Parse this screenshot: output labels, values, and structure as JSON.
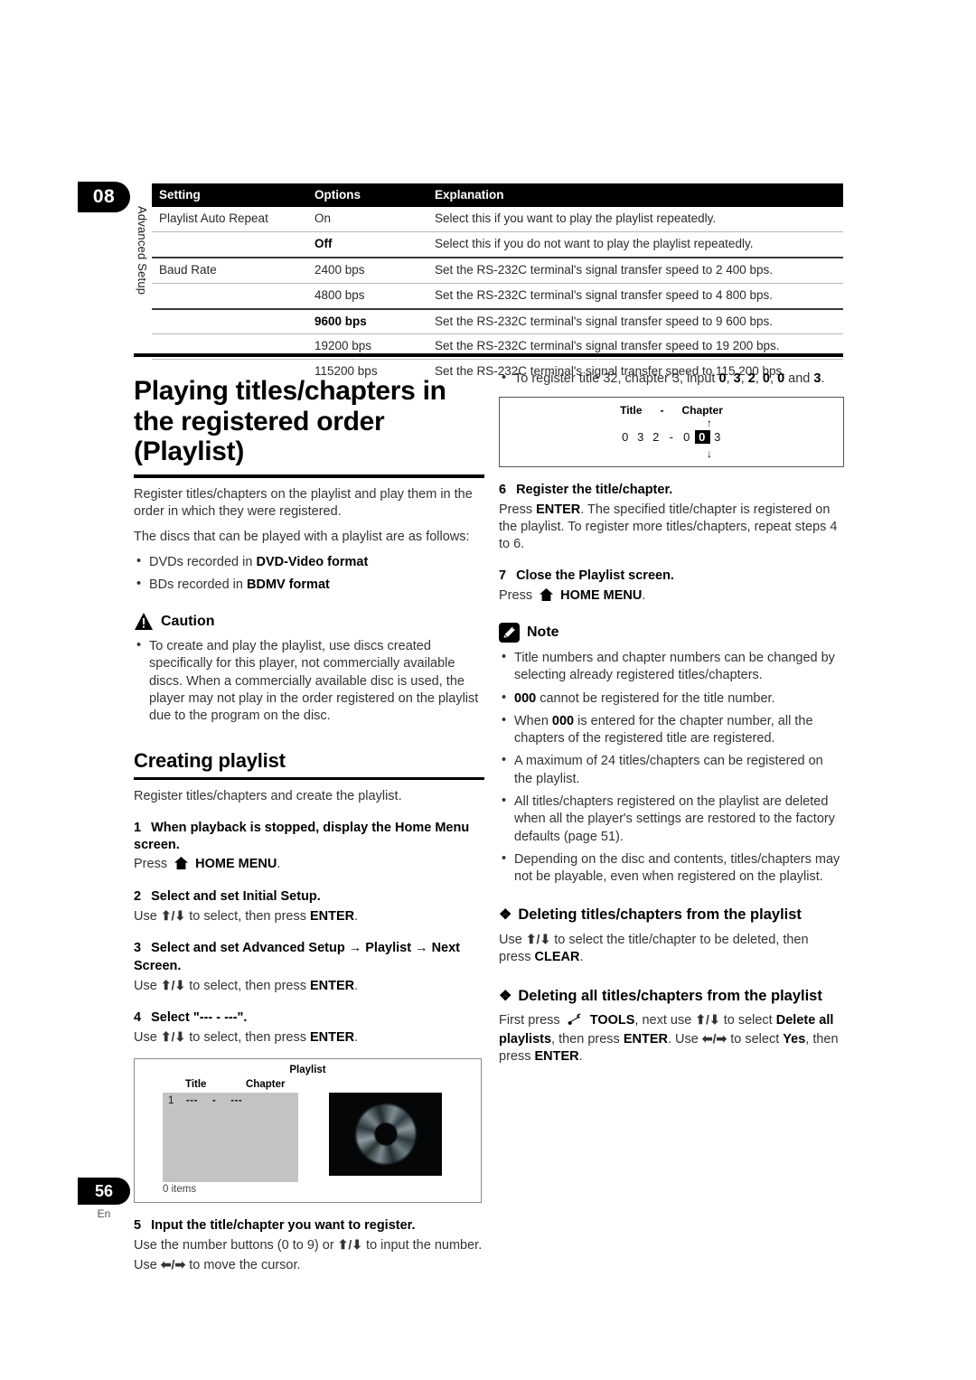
{
  "chapter": {
    "number": "08",
    "vertical_label": "Advanced Setup"
  },
  "settings_table": {
    "headers": [
      "Setting",
      "Options",
      "Explanation"
    ],
    "rows": [
      {
        "setting": "Playlist Auto Repeat",
        "option": "On",
        "option_bold": false,
        "explanation": "Select this if you want to play the playlist repeatedly.",
        "rule": "none"
      },
      {
        "setting": "",
        "option": "Off",
        "option_bold": true,
        "explanation": "Select this if you do not want to play the playlist repeatedly.",
        "rule": "thin"
      },
      {
        "setting": "Baud Rate",
        "option": "2400 bps",
        "option_bold": false,
        "explanation": "Set the RS-232C terminal's signal transfer speed to 2 400 bps.",
        "rule": "thick"
      },
      {
        "setting": "",
        "option": "4800 bps",
        "option_bold": false,
        "explanation": "Set the RS-232C terminal's signal transfer speed to 4 800 bps.",
        "rule": "thin"
      },
      {
        "setting": "",
        "option": "9600 bps",
        "option_bold": true,
        "explanation": "Set the RS-232C terminal's signal transfer speed to 9 600 bps.",
        "rule": "thick"
      },
      {
        "setting": "",
        "option": "19200 bps",
        "option_bold": false,
        "explanation": "Set the RS-232C terminal's signal transfer speed to 19 200 bps.",
        "rule": "thin"
      },
      {
        "setting": "",
        "option": "115200 bps",
        "option_bold": false,
        "explanation": "Set the RS-232C terminal's signal transfer speed to 115 200 bps.",
        "rule": "thin"
      }
    ]
  },
  "main": {
    "title": "Playing titles/chapters in the registered order (Playlist)",
    "intro1": "Register titles/chapters on the playlist and play them in the order in which they were registered.",
    "intro2": "The discs that can be played with a playlist are as follows:",
    "disc_bullets": [
      {
        "prefix": "DVDs recorded in ",
        "bold": "DVD-Video format"
      },
      {
        "prefix": "BDs recorded in ",
        "bold": "BDMV format"
      }
    ]
  },
  "caution": {
    "label": "Caution",
    "icon": "warning-triangle-icon",
    "bullets": [
      "To create and play the playlist, use discs created specifically for this player, not commercially available discs. When a commercially available disc is used, the player may not play in the order registered on the playlist due to the program on the disc."
    ]
  },
  "creating": {
    "heading": "Creating playlist",
    "intro": "Register titles/chapters and create the playlist.",
    "steps": [
      {
        "num": "1",
        "head": "When playback is stopped, display the Home Menu screen.",
        "body_pre": "Press",
        "body_icon": "home-icon",
        "body_bold": "HOME MENU",
        "body_post": "."
      },
      {
        "num": "2",
        "head": "Select and set Initial Setup.",
        "body_pre": "Use",
        "body_arrows": "up-down-arrows",
        "body_mid": " to select, then press ",
        "body_bold": "ENTER",
        "body_post": "."
      },
      {
        "num": "3",
        "head": "Select and set Advanced Setup → Playlist → Next Screen.",
        "body_pre": "Use",
        "body_arrows": "up-down-arrows",
        "body_mid": " to select, then press ",
        "body_bold": "ENTER",
        "body_post": "."
      },
      {
        "num": "4",
        "head": "Select \"--- - ---\".",
        "body_pre": "Use",
        "body_arrows": "up-down-arrows",
        "body_mid": " to select, then press ",
        "body_bold": "ENTER",
        "body_post": "."
      }
    ],
    "step5": {
      "num": "5",
      "head": "Input the title/chapter you want to register.",
      "line1_pre": "Use the number buttons (0 to 9) or ",
      "line1_post": " to input the number.",
      "line2_pre": "Use ",
      "line2_post": " to move the cursor."
    },
    "step6": {
      "num": "6",
      "head": "Register the title/chapter.",
      "body_pre": "Press ",
      "body_bold": "ENTER",
      "body_post": ". The specified title/chapter is registered on the playlist. To register more titles/chapters, repeat steps 4 to 6."
    },
    "step7": {
      "num": "7",
      "head": "Close the Playlist screen.",
      "body_pre": "Press",
      "body_icon": "home-icon",
      "body_bold": "HOME MENU",
      "body_post": "."
    }
  },
  "playlist_figure": {
    "title": "Playlist",
    "col_title": "Title",
    "col_chapter": "Chapter",
    "row_index": "1",
    "row_title_dashes": "---",
    "row_separator": "-",
    "row_chapter_dashes": "---",
    "items_count": "0 items"
  },
  "register_example": {
    "bullet": "To register title 32, chapter 3, input 0, 3, 2, 0, 0 and 3.",
    "bullet_pre": "To register title 32, chapter 3, input ",
    "bullet_digits": [
      "0",
      "3",
      "2",
      "0",
      "0"
    ],
    "bullet_and": " and ",
    "bullet_last": "3",
    "bullet_end": ".",
    "fig_title": "Title",
    "fig_dash": "-",
    "fig_chapter": "Chapter",
    "fig_digits": [
      "0",
      "3",
      "2",
      "-",
      "0",
      "0",
      "3"
    ],
    "fig_highlight_index": 5,
    "arrow_up": "↑",
    "arrow_down": "↓"
  },
  "note": {
    "label": "Note",
    "icon": "pencil-note-icon",
    "bullets": [
      {
        "text": "Title numbers and chapter numbers can be changed by selecting already registered titles/chapters."
      },
      {
        "bold_lead": "000",
        "text": " cannot be registered for the title number."
      },
      {
        "text_pre": "When ",
        "bold_mid": "000",
        "text_post": " is entered for the chapter number, all the chapters of the registered title are registered."
      },
      {
        "text": "A maximum of 24 titles/chapters can be registered on the playlist."
      },
      {
        "text": "All titles/chapters registered on the playlist are deleted when all the player's settings are restored to the factory defaults (page 51)."
      },
      {
        "text": "Depending on the disc and contents, titles/chapters may not be playable, even when registered on the playlist."
      }
    ]
  },
  "deleting_one": {
    "diamond": "❖",
    "heading": "Deleting titles/chapters from the playlist",
    "body_pre": "Use ",
    "body_mid": " to select the title/chapter to be deleted, then press ",
    "body_bold": "CLEAR",
    "body_post": "."
  },
  "deleting_all": {
    "diamond": "❖",
    "heading": "Deleting all titles/chapters from the playlist",
    "p1": "First press",
    "tools_icon": "wrench-tools-icon",
    "tools_bold": "TOOLS",
    "p2": ", next use ",
    "p3": " to select ",
    "delete_all_bold": "Delete all playlists",
    "p4": ", then press ",
    "enter_bold1": "ENTER",
    "p5": ". Use ",
    "p6": " to select ",
    "yes_bold": "Yes",
    "p7": ", then press ",
    "enter_bold2": "ENTER",
    "p8": "."
  },
  "footer": {
    "page_number": "56",
    "language": "En"
  }
}
